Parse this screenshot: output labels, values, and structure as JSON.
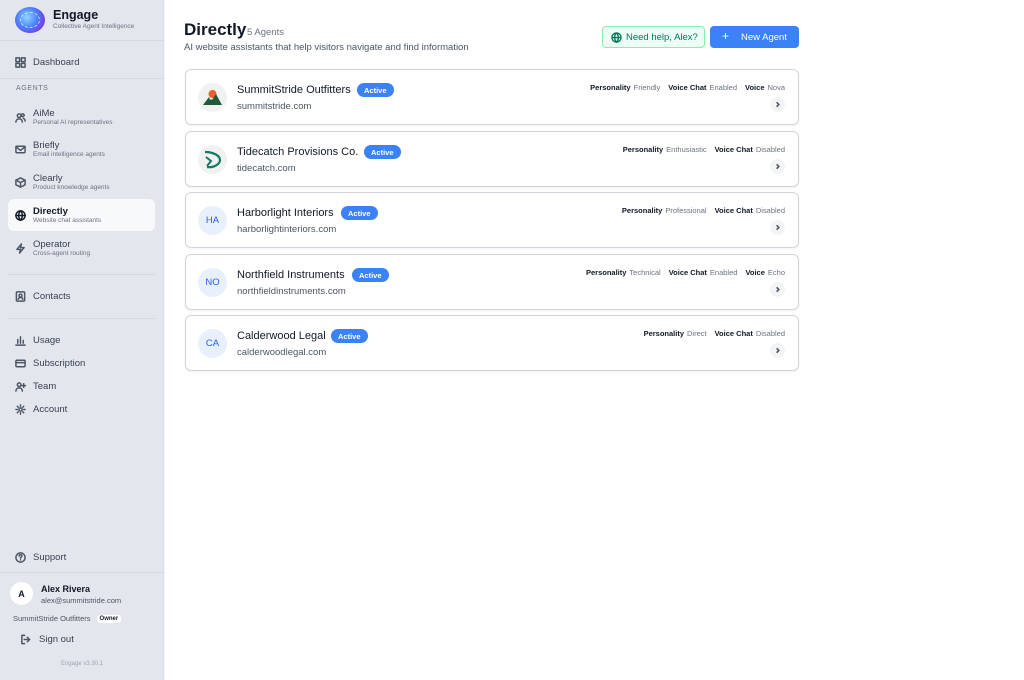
{
  "brand": {
    "name": "Engage",
    "tagline": "Collective Agent Intelligence"
  },
  "sidebar": {
    "dashboard": "Dashboard",
    "agents_section": "AGENTS",
    "agents": [
      {
        "title": "AiMe",
        "subtitle": "Personal AI representatives",
        "icon": "users-icon"
      },
      {
        "title": "Briefly",
        "subtitle": "Email intelligence agents",
        "icon": "mail-icon"
      },
      {
        "title": "Clearly",
        "subtitle": "Product knowledge agents",
        "icon": "box-icon"
      },
      {
        "title": "Directly",
        "subtitle": "Website chat assistants",
        "icon": "globe-icon",
        "active": true
      },
      {
        "title": "Operator",
        "subtitle": "Cross-agent routing",
        "icon": "zap-icon"
      }
    ],
    "contacts": "Contacts",
    "usage": "Usage",
    "subscription": "Subscription",
    "team": "Team",
    "account": "Account",
    "support": "Support",
    "user": {
      "initial": "A",
      "name": "Alex Rivera",
      "email": "alex@summitstride.com"
    },
    "org": {
      "name": "SummitStride Outfitters",
      "role": "Owner"
    },
    "signout": "Sign out",
    "version": "Engage v3.30.1"
  },
  "header": {
    "title": "Directly",
    "count": "5 Agents",
    "subtitle": "AI website assistants that help visitors navigate and find information",
    "help_label": "Need help, Alex?",
    "new_agent_label": "New Agent"
  },
  "labels": {
    "personality": "Personality",
    "voice_chat": "Voice Chat",
    "voice": "Voice"
  },
  "agents": [
    {
      "name": "SummitStride Outfitters",
      "status": "Active",
      "domain": "summitstride.com",
      "logo": "mountain-logo",
      "personality": "Friendly",
      "voice_chat": "Enabled",
      "voice": "Nova"
    },
    {
      "name": "Tidecatch Provisions Co.",
      "status": "Active",
      "domain": "tidecatch.com",
      "logo": "fish-logo",
      "personality": "Enthusiastic",
      "voice_chat": "Disabled"
    },
    {
      "name": "Harborlight Interiors",
      "status": "Active",
      "domain": "harborlightinteriors.com",
      "initials": "HA",
      "personality": "Professional",
      "voice_chat": "Disabled"
    },
    {
      "name": "Northfield Instruments",
      "status": "Active",
      "domain": "northfieldinstruments.com",
      "initials": "NO",
      "personality": "Technical",
      "voice_chat": "Enabled",
      "voice": "Echo"
    },
    {
      "name": "Calderwood Legal",
      "status": "Active",
      "domain": "calderwoodlegal.com",
      "initials": "CA",
      "personality": "Direct",
      "voice_chat": "Disabled"
    }
  ],
  "colors": {
    "accent": "#3b82f6",
    "help_green": "#047857",
    "sidebar_bg": "#e4e6ee"
  }
}
